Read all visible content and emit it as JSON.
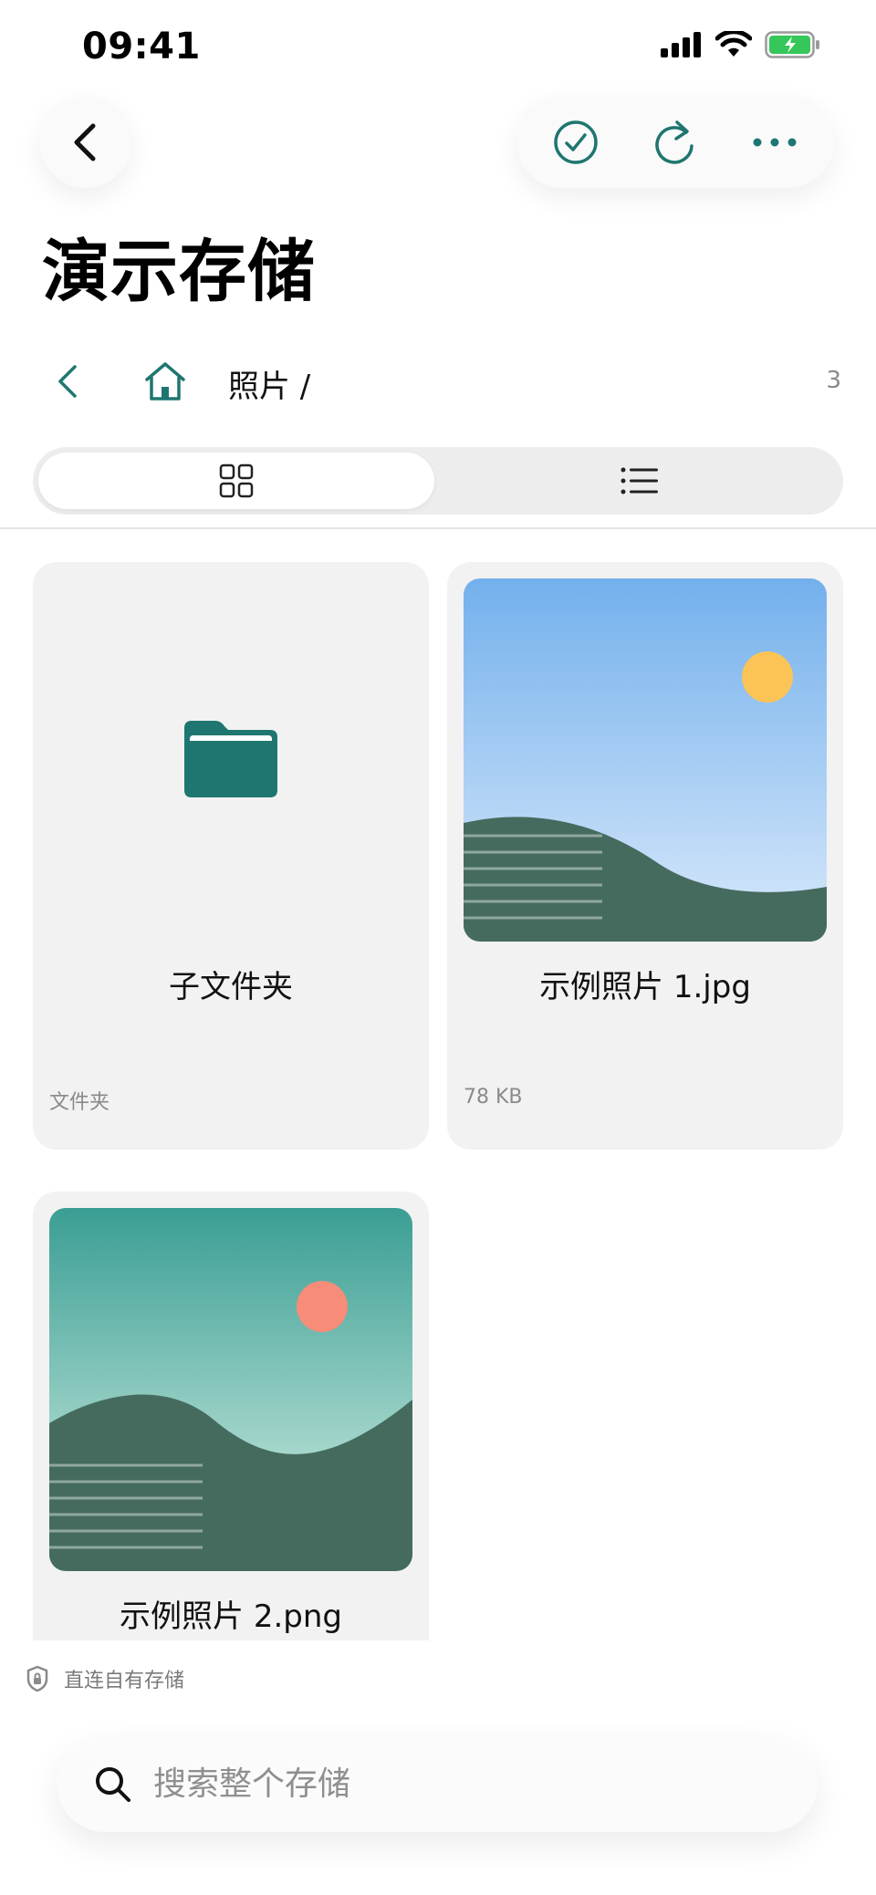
{
  "status_bar": {
    "time": "09:41"
  },
  "header": {
    "title": "演示存储"
  },
  "breadcrumb": {
    "path": "照片 /",
    "count": "3"
  },
  "grid": {
    "items": [
      {
        "name": "子文件夹",
        "meta": "文件夹",
        "kind": "folder"
      },
      {
        "name": "示例照片 1.jpg",
        "meta": "78 KB",
        "kind": "image"
      },
      {
        "name": "示例照片 2.png",
        "meta": "",
        "kind": "image"
      }
    ]
  },
  "footer": {
    "note": "直连自有存储"
  },
  "search": {
    "placeholder": "搜索整个存储"
  },
  "colors": {
    "accent": "#1f7670",
    "folder": "#1f7670",
    "card_bg": "#f2f2f2",
    "toggle_bg": "#ededed"
  },
  "icons": [
    "back-icon",
    "check-circle-icon",
    "refresh-icon",
    "more-icon",
    "home-icon",
    "grid-view-icon",
    "list-view-icon",
    "folder-icon",
    "lock-shield-icon",
    "search-icon"
  ]
}
